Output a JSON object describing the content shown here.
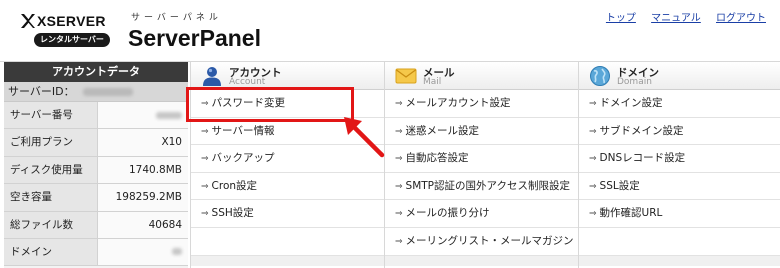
{
  "header": {
    "logo_text": "XSERVER",
    "logo_badge": "レンタルサーバー",
    "brand_sub": "サーバーパネル",
    "brand_main": "ServerPanel",
    "links": [
      "トップ",
      "マニュアル",
      "ログアウト"
    ]
  },
  "account": {
    "title": "アカウントデータ",
    "server_id_label": "サーバーID：",
    "rows": [
      {
        "label": "サーバー番号",
        "value": ""
      },
      {
        "label": "ご利用プラン",
        "value": "X10"
      },
      {
        "label": "ディスク使用量",
        "value": "1740.8MB"
      },
      {
        "label": "空き容量",
        "value": "198259.2MB"
      },
      {
        "label": "総ファイル数",
        "value": "40684"
      },
      {
        "label": "ドメイン",
        "value": ""
      }
    ]
  },
  "menu": {
    "account": {
      "title": "アカウント",
      "subtitle": "Account",
      "items": [
        "パスワード変更",
        "サーバー情報",
        "バックアップ",
        "Cron設定",
        "SSH設定",
        ""
      ]
    },
    "mail": {
      "title": "メール",
      "subtitle": "Mail",
      "items": [
        "メールアカウント設定",
        "迷惑メール設定",
        "自動応答設定",
        "SMTP認証の国外アクセス制限設定",
        "メールの振り分け",
        "メーリングリスト・メールマガジン"
      ]
    },
    "domain": {
      "title": "ドメイン",
      "subtitle": "Domain",
      "items": [
        "ドメイン設定",
        "サブドメイン設定",
        "DNSレコード設定",
        "SSL設定",
        "動作確認URL",
        ""
      ]
    }
  },
  "colors": {
    "highlight": "#e21616",
    "link": "#1a3fa6",
    "panel_dark": "#3a3a3a"
  }
}
